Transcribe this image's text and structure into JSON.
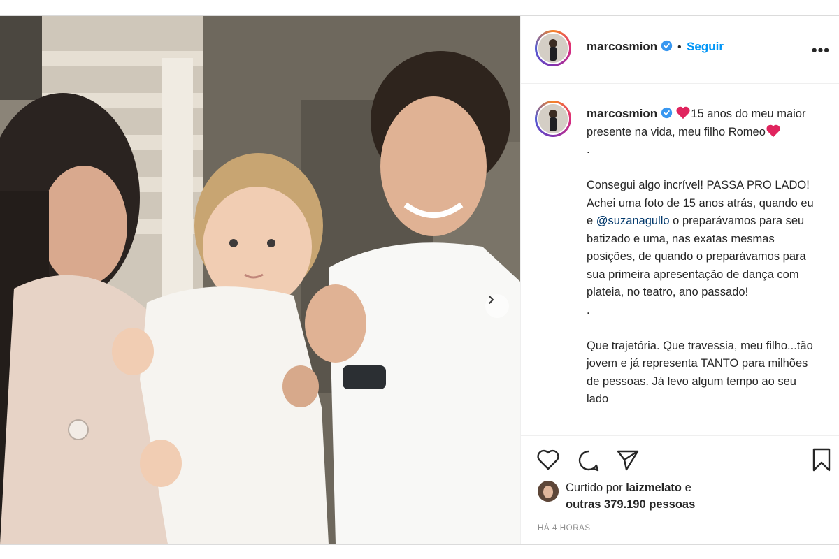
{
  "post": {
    "author": "marcosmion",
    "follow_label": "Seguir",
    "separator": "•",
    "more_label": "•••",
    "caption": {
      "line1_after_heart": "15 anos do meu maior presente na vida, meu filho Romeo",
      "dot1": ".",
      "para2_before_mention": "Consegui algo incrível! PASSA PRO LADO! Achei uma foto de 15 anos atrás, quando eu e ",
      "mention": "@suzanagullo",
      "para2_after_mention": " o preparávamos para seu batizado e uma, nas exatas mesmas posições, de quando o preparávamos para sua primeira apresentação de dança com plateia, no teatro, ano passado!",
      "dot2": ".",
      "para3": "Que trajetória. Que travessia, meu filho...tão jovem e já representa TANTO para milhões de pessoas. Já levo algum tempo ao seu lado"
    },
    "likes": {
      "prefix": "Curtido por ",
      "liker": "laizmelato",
      "and": " e",
      "others": "outras 379.190 pessoas"
    },
    "time": "HÁ 4 HORAS"
  },
  "icons": {
    "verified": "verified-badge-icon",
    "like": "heart-outline-icon",
    "comment": "comment-icon",
    "share": "paper-plane-icon",
    "save": "bookmark-icon",
    "next": "chevron-right-icon"
  },
  "colors": {
    "link": "#0095f6",
    "mention": "#00376b",
    "heart": "#e0245e",
    "muted": "#8e8e8e"
  }
}
